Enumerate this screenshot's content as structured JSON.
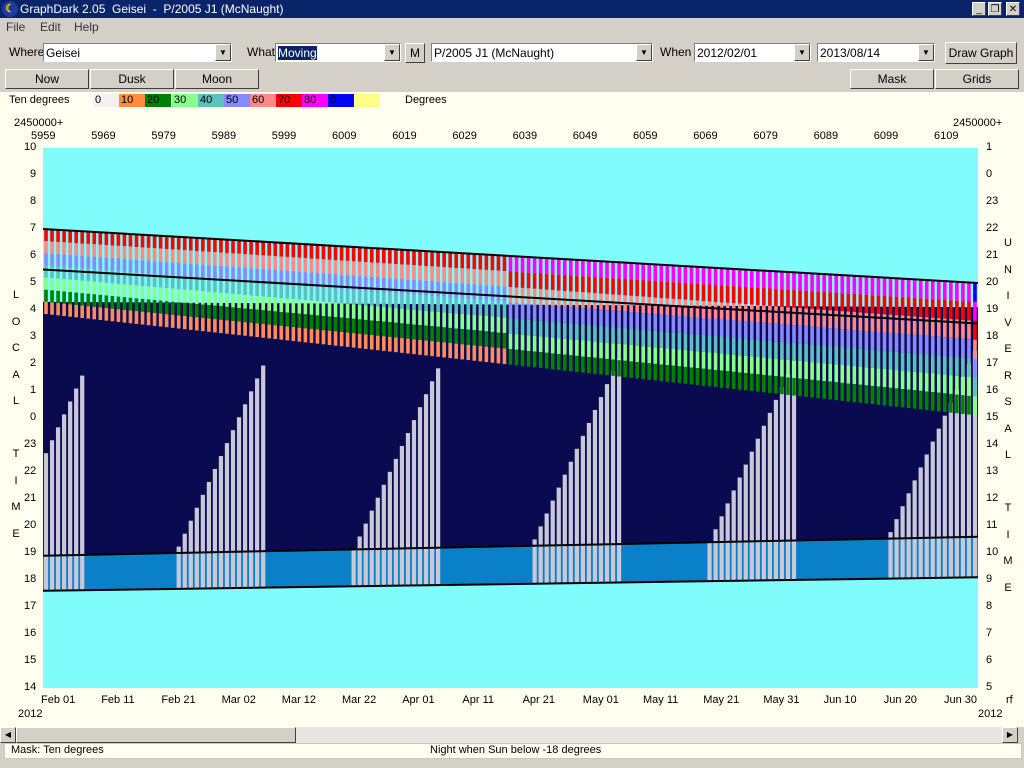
{
  "window": {
    "title": "GraphDark 2.05  Geisei  -  P/2005 J1 (McNaught)"
  },
  "menu": {
    "file": "File",
    "edit": "Edit",
    "help": "Help"
  },
  "toolbar": {
    "where_label": "Where",
    "where_value": "Geisei",
    "what_label": "What",
    "what_value": "Moving",
    "m_button": "M",
    "object_value": "P/2005 J1 (McNaught)",
    "when_label": "When",
    "start_date": "2012/02/01",
    "end_date": "2013/08/14",
    "draw_graph": "Draw Graph"
  },
  "buttons": {
    "now": "Now",
    "dusk": "Dusk",
    "moon": "Moon",
    "mask": "Mask",
    "grids": "Grids"
  },
  "legend": {
    "title": "Ten degrees",
    "unit": "Degrees",
    "items": [
      {
        "label": "0",
        "color": "#f2f2f2"
      },
      {
        "label": "10",
        "color": "#ff8c40"
      },
      {
        "label": "20",
        "color": "#008000"
      },
      {
        "label": "30",
        "color": "#88ff88"
      },
      {
        "label": "40",
        "color": "#5fc0c0"
      },
      {
        "label": "50",
        "color": "#8888ff"
      },
      {
        "label": "60",
        "color": "#ff8888"
      },
      {
        "label": "70",
        "color": "#ff0000"
      },
      {
        "label": "80",
        "color": "#ff00ff"
      },
      {
        "label": "0",
        "color": "#0000ff"
      },
      {
        "label": "",
        "color": "#ffff88"
      }
    ]
  },
  "chart_data": {
    "type": "heatmap",
    "jd_prefix_left": "2450000+",
    "jd_prefix_right": "2450000+",
    "jd_ticks": [
      "5959",
      "5969",
      "5979",
      "5989",
      "5999",
      "6009",
      "6019",
      "6029",
      "6039",
      "6049",
      "6059",
      "6069",
      "6079",
      "6089",
      "6099",
      "6109"
    ],
    "date_ticks": [
      "Feb 01",
      "Feb 11",
      "Feb 21",
      "Mar 02",
      "Mar 12",
      "Mar 22",
      "Apr 01",
      "Apr 11",
      "Apr 21",
      "May 01",
      "May 11",
      "May 21",
      "May 31",
      "Jun 10",
      "Jun 20",
      "Jun 30"
    ],
    "year_left": "2012",
    "year_right": "2012",
    "right_corner": "rf",
    "local_time_ticks": [
      "10",
      "9",
      "8",
      "7",
      "6",
      "5",
      "4",
      "3",
      "2",
      "1",
      "0",
      "23",
      "22",
      "21",
      "20",
      "19",
      "18",
      "17",
      "16",
      "15",
      "14"
    ],
    "universal_time_ticks": [
      "1",
      "0",
      "23",
      "22",
      "21",
      "20",
      "19",
      "18",
      "17",
      "16",
      "15",
      "14",
      "13",
      "12",
      "11",
      "10",
      "9",
      "8",
      "7",
      "6",
      "5"
    ],
    "left_axis_title": [
      "L",
      "O",
      "C",
      "A",
      "L",
      "",
      "T",
      "I",
      "M",
      "E"
    ],
    "right_axis_title": [
      "U",
      "N",
      "I",
      "V",
      "E",
      "R",
      "S",
      "A",
      "L",
      "",
      "T",
      "I",
      "M",
      "E"
    ],
    "hours_range": [
      14,
      34
    ],
    "days": 155,
    "colors": {
      "day": "#80fcfc",
      "twilight": "#0a80c8",
      "night": "#0a0a50",
      "moon": "#c8c8d8",
      "outline": "#000000",
      "bands": [
        "#ff8c5a",
        "#008000",
        "#88ff88",
        "#5fc0c0",
        "#8888ff",
        "#ff8888",
        "#ff0000",
        "#ff00ff",
        "#0000ff"
      ]
    },
    "sunset_hours": [
      18.9,
      19.6
    ],
    "dusk_hours": [
      17.6,
      18.1
    ],
    "dawn_hours": [
      28.3,
      28.1
    ],
    "sunrise_hours": [
      29.2,
      28.2
    ],
    "object_set_hours": [
      31.0,
      29.0
    ],
    "object_culmination_hours": [
      29.5,
      27.5
    ]
  },
  "status": {
    "mask": "Mask:  Ten degrees",
    "night": "Night when Sun below -18 degrees"
  }
}
